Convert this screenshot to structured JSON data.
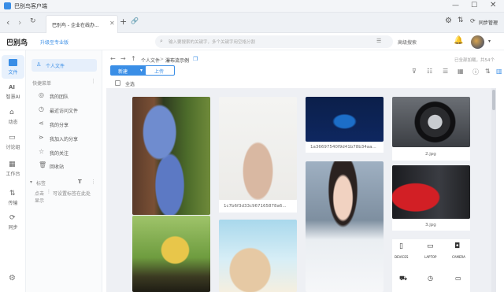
{
  "titlebar": {
    "app_title": "巴别鸟客户端"
  },
  "tab": {
    "title": "巴别鸟 - 企业在线办..."
  },
  "toolbar": {
    "sync_label": "同步管理"
  },
  "header": {
    "logo": "巴别鸟",
    "upgrade": "升级至专业版",
    "search_placeholder": "输入要搜索的关键字，多个关键字用空格分割",
    "advanced_search": "高级搜索"
  },
  "leftnav": {
    "items": [
      {
        "label": "文件",
        "icon": "folder-icon"
      },
      {
        "label": "智慧AI",
        "icon": "ai-icon"
      },
      {
        "label": "动态",
        "icon": "activity-icon"
      },
      {
        "label": "讨论组",
        "icon": "chat-icon"
      },
      {
        "label": "工作台",
        "icon": "grid-icon"
      },
      {
        "label": "传输",
        "icon": "transfer-icon"
      },
      {
        "label": "同步",
        "icon": "sync-icon"
      }
    ]
  },
  "sidebar": {
    "personal_files": "个人文件",
    "quick_menu": "快捷菜单",
    "items": [
      "我的团队",
      "最近访问文件",
      "我的分享",
      "我加入的分享",
      "我的关注",
      "回收站"
    ],
    "tags_title": "标签",
    "tags_hint_1": "点击",
    "tags_hint_2": "可设置标签在此处",
    "tags_hint_3": "显示"
  },
  "breadcrumb": {
    "items": [
      "个人文件",
      "瀑布流示例"
    ],
    "sep": ">"
  },
  "actions": {
    "new_label": "新建",
    "upload_label": "上传",
    "select_all": "全选",
    "usage": "已全部加载，共54个"
  },
  "gallery": {
    "captions": [
      "1a36697540f9d41b78b34aa...",
      "2.jpg",
      "1c7b6f3d33c967165878a6...",
      "3.jpg"
    ]
  },
  "devices": [
    "DEVICES",
    "LAPTOP",
    "CAMERA"
  ],
  "colors": {
    "accent": "#3a8ee6",
    "nav_active": "#3a8ee6"
  }
}
